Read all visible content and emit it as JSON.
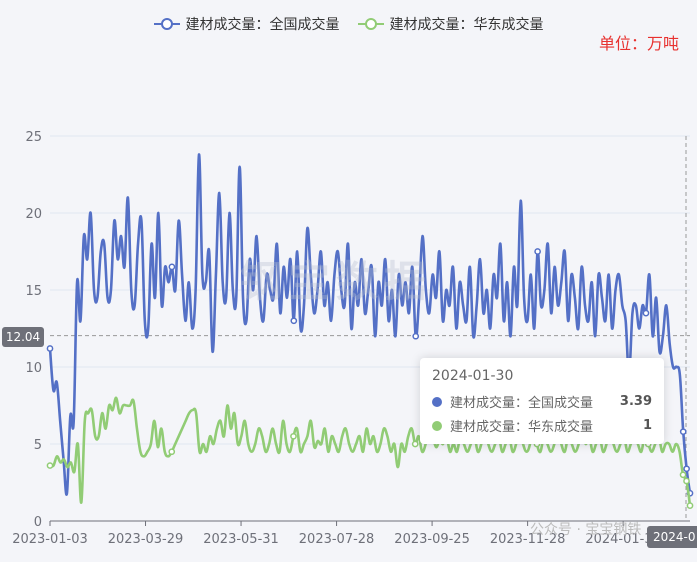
{
  "legend": {
    "series0": "建材成交量：全国成交量",
    "series1": "建材成交量：华东成交量"
  },
  "unit_label": "单位：万吨",
  "tooltip": {
    "date": "2024-01-30",
    "rows": [
      {
        "name": "建材成交量：全国成交量",
        "value": "3.39",
        "color": "#5470c6"
      },
      {
        "name": "建材成交量：华东成交量",
        "value": "1",
        "color": "#91cc75"
      }
    ]
  },
  "crosshair": {
    "y_label": "12.04",
    "x_label": "2024-0"
  },
  "watermark": {
    "center": "钢宝数据",
    "corner": "公众号 · 宝宝钢铁"
  },
  "colors": {
    "national": "#5470c6",
    "east": "#91cc75",
    "grid": "#e0e6f1",
    "axis": "#6e7079"
  },
  "chart_data": {
    "type": "line",
    "x_ticks": [
      "2023-01-03",
      "2023-03-29",
      "2023-05-31",
      "2023-07-28",
      "2023-09-25",
      "2023-11-28",
      "2024-01-30"
    ],
    "y_ticks": [
      0,
      5,
      10,
      15,
      20,
      25
    ],
    "ylim": [
      0,
      25
    ],
    "series": [
      {
        "name": "建材成交量：全国成交量",
        "color": "#5470c6",
        "values": [
          11.2,
          8.5,
          9.0,
          6.5,
          4.0,
          1.8,
          6.8,
          6.5,
          15.5,
          13.0,
          18.5,
          17.0,
          20.0,
          15.0,
          14.5,
          17.5,
          18.0,
          14.5,
          15.0,
          19.5,
          17.0,
          18.5,
          16.5,
          21.0,
          15.0,
          14.0,
          18.0,
          19.5,
          13.0,
          12.5,
          18.0,
          14.5,
          20.0,
          14.0,
          16.5,
          15.5,
          16.5,
          15.0,
          19.5,
          16.0,
          13.0,
          15.5,
          12.5,
          15.0,
          23.8,
          16.0,
          15.5,
          17.5,
          11.0,
          16.0,
          21.3,
          15.5,
          14.5,
          20.0,
          15.0,
          14.5,
          23.0,
          14.5,
          13.0,
          17.0,
          15.0,
          18.5,
          14.5,
          13.0,
          16.0,
          15.0,
          14.5,
          18.0,
          13.5,
          16.5,
          14.5,
          17.0,
          13.0,
          17.5,
          12.5,
          14.0,
          19.0,
          16.0,
          13.5,
          15.0,
          17.5,
          14.0,
          15.5,
          13.0,
          16.0,
          17.5,
          15.0,
          14.0,
          18.0,
          12.5,
          15.5,
          14.0,
          17.0,
          13.5,
          15.0,
          16.5,
          12.0,
          15.5,
          14.0,
          17.0,
          13.0,
          15.0,
          12.0,
          16.0,
          14.0,
          15.5,
          13.5,
          16.5,
          12.0,
          14.5,
          18.5,
          15.0,
          13.5,
          16.0,
          14.5,
          17.5,
          13.0,
          15.0,
          14.0,
          16.5,
          12.5,
          15.5,
          14.0,
          13.0,
          16.5,
          12.0,
          14.0,
          17.0,
          13.5,
          15.0,
          12.5,
          16.0,
          14.5,
          18.0,
          13.0,
          15.5,
          12.0,
          16.5,
          14.0,
          20.8,
          14.5,
          13.0,
          16.0,
          12.5,
          17.5,
          14.0,
          15.0,
          18.0,
          13.5,
          16.5,
          14.0,
          15.5,
          17.5,
          13.0,
          16.0,
          14.5,
          12.5,
          16.5,
          14.0,
          13.0,
          15.5,
          12.0,
          16.0,
          14.5,
          13.0,
          16.0,
          12.5,
          15.0,
          16.0,
          14.0,
          13.0,
          9.5,
          13.5,
          14.0,
          12.5,
          14.0,
          13.5,
          16.0,
          12.0,
          14.5,
          11.0,
          12.0,
          14.0,
          11.5,
          10.0,
          10.0,
          9.5,
          5.8,
          3.39,
          1.8
        ]
      },
      {
        "name": "建材成交量：华东成交量",
        "color": "#91cc75",
        "values": [
          3.6,
          3.6,
          4.2,
          3.8,
          4.0,
          3.5,
          3.8,
          3.2,
          5.0,
          1.2,
          6.5,
          7.0,
          7.2,
          5.5,
          5.5,
          7.0,
          6.0,
          7.5,
          7.2,
          8.0,
          7.0,
          7.5,
          7.5,
          7.5,
          7.8,
          6.0,
          4.5,
          4.2,
          4.5,
          5.0,
          6.5,
          4.8,
          6.0,
          4.5,
          4.2,
          4.5,
          5.0,
          5.5,
          6.0,
          6.5,
          7.0,
          7.2,
          7.0,
          4.5,
          5.0,
          4.5,
          5.5,
          5.0,
          6.0,
          6.5,
          5.5,
          7.5,
          6.0,
          7.0,
          5.0,
          5.5,
          6.5,
          5.0,
          4.5,
          5.0,
          6.0,
          5.5,
          4.5,
          5.0,
          6.0,
          5.0,
          4.5,
          6.5,
          5.0,
          4.5,
          5.5,
          6.0,
          4.5,
          5.0,
          5.5,
          6.5,
          4.8,
          5.2,
          5.0,
          6.0,
          4.5,
          5.5,
          5.0,
          4.5,
          5.5,
          6.0,
          5.0,
          4.5,
          5.0,
          5.5,
          4.5,
          6.0,
          5.0,
          5.5,
          4.5,
          5.0,
          6.0,
          5.5,
          4.5,
          5.0,
          3.5,
          5.0,
          4.5,
          5.5,
          6.0,
          5.0,
          5.5,
          4.5,
          5.0,
          6.0,
          5.5,
          4.8,
          5.2,
          5.0,
          5.5,
          4.5,
          5.0,
          4.5,
          5.5,
          5.0,
          4.5,
          5.0,
          5.5,
          4.5,
          5.0,
          6.0,
          5.0,
          4.5,
          5.0,
          5.5,
          4.5,
          5.0,
          5.5,
          4.5,
          5.0,
          6.0,
          5.0,
          4.5,
          5.0,
          6.5,
          5.0,
          4.5,
          5.5,
          5.0,
          4.5,
          5.0,
          6.0,
          5.0,
          4.5,
          5.5,
          5.0,
          4.5,
          5.0,
          6.0,
          5.0,
          5.5,
          4.5,
          5.0,
          5.5,
          4.5,
          5.0,
          6.0,
          5.0,
          4.5,
          5.0,
          5.5,
          4.5,
          5.0,
          5.5,
          5.0,
          4.5,
          5.5,
          5.0,
          4.5,
          5.0,
          5.5,
          4.5,
          5.0,
          5.0,
          4.5,
          5.0,
          4.5,
          3.0,
          2.6,
          1.0
        ]
      }
    ]
  }
}
